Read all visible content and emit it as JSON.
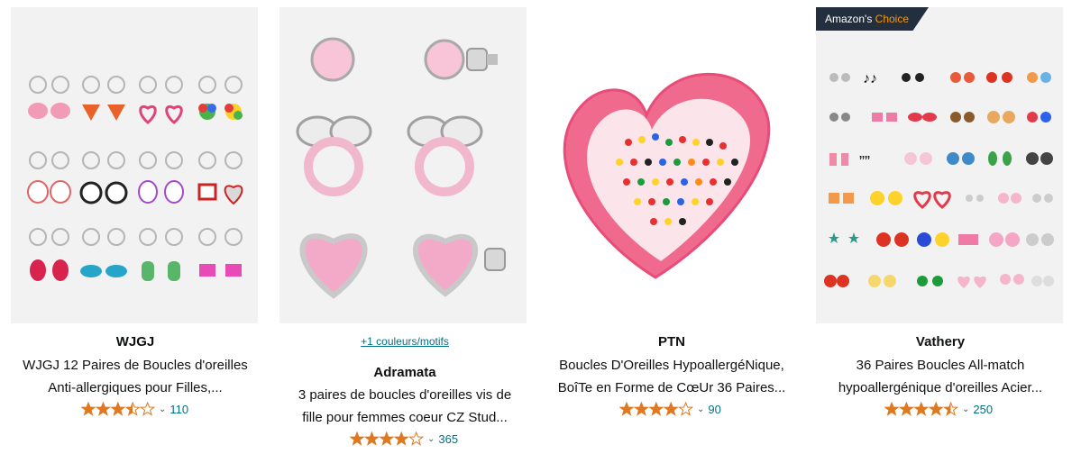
{
  "products": [
    {
      "brand": "WJGJ",
      "title_line1": "WJGJ 12 Paires de Boucles d'oreilles",
      "title_line2": "Anti-allergiques pour Filles,...",
      "rating": 3.5,
      "review_count": "110",
      "image_icon": "hoop-earrings-image"
    },
    {
      "brand": "Adramata",
      "swatch_link": "+1 couleurs/motifs",
      "title_line1": "3 paires de boucles d'oreilles vis de",
      "title_line2": "fille pour femmes coeur CZ Stud...",
      "rating": 4.0,
      "review_count": "365",
      "image_icon": "stud-earrings-image"
    },
    {
      "brand": "PTN",
      "title_line1": "Boucles D'Oreilles HypoallergéNique,",
      "title_line2": "BoîTe en Forme de CœUr 36 Paires...",
      "rating": 4.0,
      "review_count": "90",
      "image_icon": "heart-box-image"
    },
    {
      "brand": "Vathery",
      "badge_left": "Amazon's",
      "badge_right": "Choice",
      "title_line1": "36 Paires Boucles All-match",
      "title_line2": "hypoallergénique d'oreilles Acier...",
      "rating": 4.5,
      "review_count": "250",
      "image_icon": "stud-grid-image"
    }
  ],
  "colors": {
    "link": "#007185",
    "star": "#de7921",
    "badge_bg": "#232f3e",
    "badge_accent": "#ff9900",
    "pink_box": "#f06a8e"
  }
}
